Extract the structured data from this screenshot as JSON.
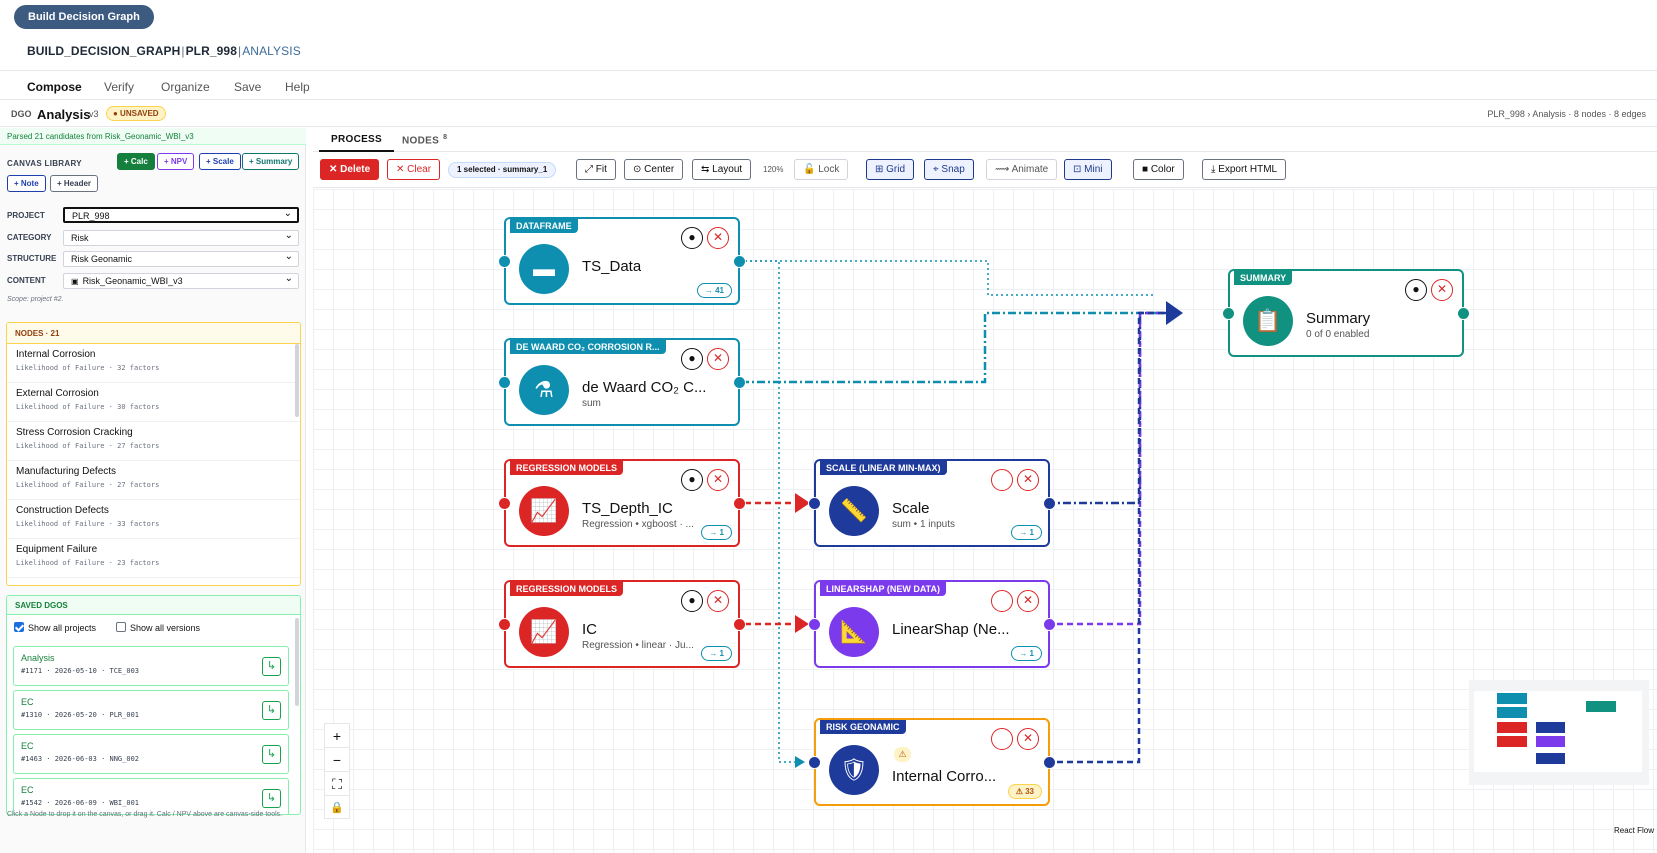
{
  "header": {
    "top_button": "Build Decision Graph",
    "breadcrumb_main": "BUILD_DECISION_GRAPH",
    "breadcrumb_sep": "|",
    "breadcrumb_project": "PLR_998",
    "breadcrumb_section": "ANALYSIS"
  },
  "menu": [
    "Compose",
    "Verify",
    "Organize",
    "Save",
    "Help"
  ],
  "dgo": {
    "tag": "DGO",
    "name": "Analysis",
    "version": "v3",
    "status": "● UNSAVED",
    "meta": "PLR_998 › Analysis · 8 nodes · 8 edges"
  },
  "sidebar": {
    "parsed_note": "Parsed 21 candidates from Risk_Geonamic_WBI_v3",
    "library_title": "CANVAS LIBRARY",
    "library_buttons": [
      "+ Calc",
      "+ NPV",
      "+ Scale",
      "+ Summary",
      "+ Note",
      "+ Header"
    ],
    "fields": [
      {
        "label": "PROJECT",
        "value": "PLR_998"
      },
      {
        "label": "CATEGORY",
        "value": "Risk"
      },
      {
        "label": "STRUCTURE",
        "value": "Risk Geonamic"
      },
      {
        "label": "CONTENT",
        "value": "Risk_Geonamic_WBI_v3"
      }
    ],
    "scope": "Scope: project #2.",
    "nodes_title": "NODES · 21",
    "nodes": [
      {
        "title": "Internal Corrosion",
        "sub": "Likelihood of Failure · 32 factors"
      },
      {
        "title": "External Corrosion",
        "sub": "Likelihood of Failure · 30 factors"
      },
      {
        "title": "Stress Corrosion Cracking",
        "sub": "Likelihood of Failure · 27 factors"
      },
      {
        "title": "Manufacturing Defects",
        "sub": "Likelihood of Failure · 27 factors"
      },
      {
        "title": "Construction Defects",
        "sub": "Likelihood of Failure · 33 factors"
      },
      {
        "title": "Equipment Failure",
        "sub": "Likelihood of Failure · 23 factors"
      }
    ],
    "saved_title": "SAVED DGOS",
    "show_all_projects": "Show all projects",
    "show_all_versions": "Show all versions",
    "saved": [
      {
        "title": "Analysis",
        "sub": "#1171 · 2026-05-10 · TCE_003"
      },
      {
        "title": "EC",
        "sub": "#1310 · 2026-05-20 · PLR_001"
      },
      {
        "title": "EC",
        "sub": "#1463 · 2026-06-03 · NNG_002"
      },
      {
        "title": "EC",
        "sub": "#1542 · 2026-06-09 · WBI_001"
      }
    ],
    "hint": "Click a Node to drop it on the canvas, or drag it. Calc / NPV above are canvas-side tools."
  },
  "tabs": {
    "process": "PROCESS",
    "nodes": "NODES",
    "nodes_count": "8"
  },
  "toolbar": {
    "delete": "✕ Delete",
    "clear": "✕ Clear",
    "selection": "1 selected · summary_1",
    "fit": "⤢ Fit",
    "center": "⊙ Center",
    "layout": "⇆ Layout",
    "zoom": "120%",
    "lock": "🔓 Lock",
    "grid": "⊞ Grid",
    "snap": "⌖ Snap",
    "animate": "⟿ Animate",
    "mini": "⊡ Mini",
    "color": "■ Color",
    "export": "⤓ Export HTML"
  },
  "graph": {
    "nodes": [
      {
        "id": "ts_data",
        "label": "DATAFRAME",
        "name": "TS_Data",
        "sub": "",
        "badge": "→ 41",
        "color": "#0e8fb0",
        "icon": "dataframe-icon",
        "glyph": "▬"
      },
      {
        "id": "dewaard",
        "label": "DE WAARD CO₂ CORROSION R...",
        "name": "de Waard CO₂ C...",
        "sub": "sum",
        "badge": "",
        "color": "#0e8fb0",
        "icon": "test-tube-icon",
        "glyph": "⚗"
      },
      {
        "id": "ts_depth",
        "label": "REGRESSION MODELS",
        "name": "TS_Depth_IC",
        "sub": "Regression • xgboost · ...",
        "badge": "→ 1",
        "color": "#dc2626",
        "icon": "chart-icon",
        "glyph": "📈"
      },
      {
        "id": "ic",
        "label": "REGRESSION MODELS",
        "name": "IC",
        "sub": "Regression • linear · Ju...",
        "badge": "→ 1",
        "color": "#dc2626",
        "icon": "chart-icon",
        "glyph": "📈"
      },
      {
        "id": "scale",
        "label": "SCALE (LINEAR MIN-MAX)",
        "name": "Scale",
        "sub": "sum • 1 inputs",
        "badge": "→ 1",
        "color": "#1e3a9a",
        "icon": "ruler-icon",
        "glyph": "📏"
      },
      {
        "id": "linearshap",
        "label": "LINEARSHAP (NEW DATA)",
        "name": "LinearShap (Ne...",
        "sub": "",
        "badge": "→ 1",
        "color": "#7c3aed",
        "icon": "triangle-ruler-icon",
        "glyph": "📐"
      },
      {
        "id": "risk",
        "label": "RISK GEONAMIC",
        "name": "Internal Corro...",
        "sub": "",
        "badge": "⚠ 33",
        "color": "#1e3a9a",
        "border": "#f59e0b",
        "icon": "shield-icon",
        "glyph": "🛡"
      },
      {
        "id": "summary",
        "label": "SUMMARY",
        "name": "Summary",
        "sub": "0 of 0 enabled",
        "badge": "",
        "color": "#119281",
        "icon": "clipboard-icon",
        "glyph": "📋"
      }
    ],
    "warning_glyph": "⚠"
  },
  "zoom_controls": [
    "+",
    "−",
    "⛶",
    "🔒"
  ],
  "attribution": "React Flow"
}
